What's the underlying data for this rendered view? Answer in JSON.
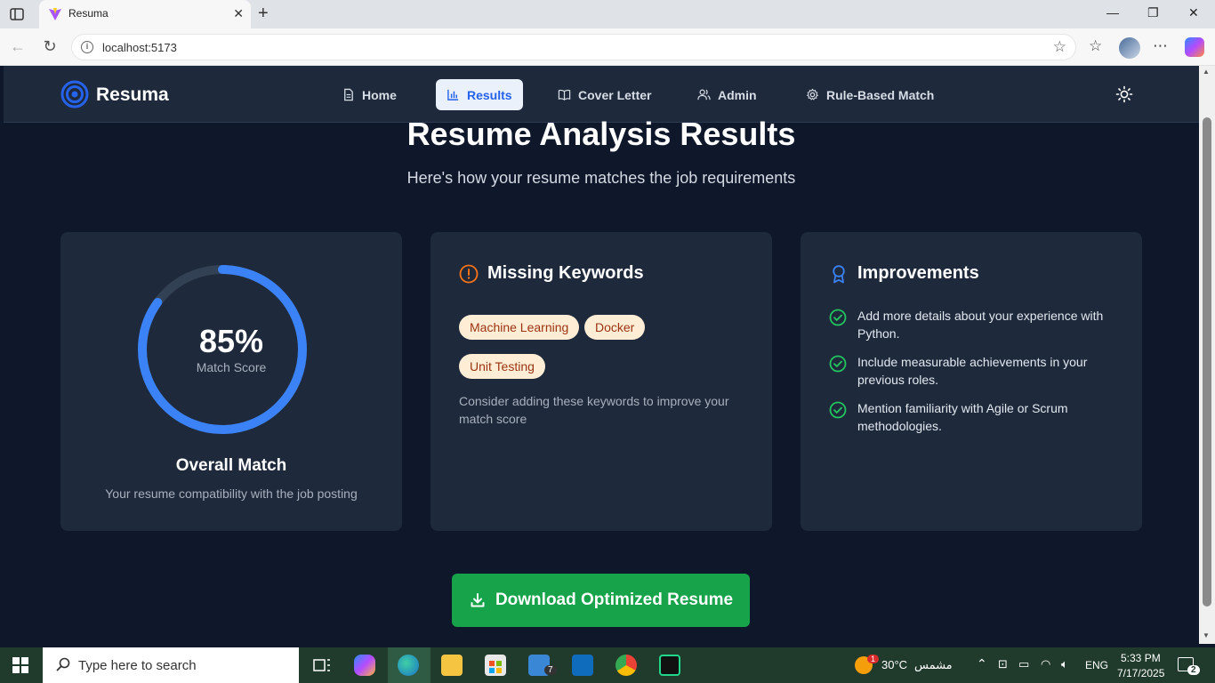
{
  "browser": {
    "tab_title": "Resuma",
    "url": "localhost:5173"
  },
  "app": {
    "brand": "Resuma",
    "nav": [
      {
        "label": "Home",
        "icon": "document-icon"
      },
      {
        "label": "Results",
        "icon": "bar-chart-icon",
        "active": true
      },
      {
        "label": "Cover Letter",
        "icon": "book-open-icon"
      },
      {
        "label": "Admin",
        "icon": "users-icon"
      },
      {
        "label": "Rule-Based Match",
        "icon": "gear-icon"
      }
    ],
    "theme_toggle_icon": "sun-icon"
  },
  "page": {
    "title": "Resume Analysis Results",
    "subtitle": "Here's how your resume matches the job requirements"
  },
  "match": {
    "score_text": "85%",
    "score_value": 85,
    "score_label": "Match Score",
    "title": "Overall Match",
    "description": "Your resume compatibility with the job posting"
  },
  "missing": {
    "title": "Missing Keywords",
    "keywords": [
      "Machine Learning",
      "Docker",
      "Unit Testing"
    ],
    "hint": "Consider adding these keywords to improve your match score"
  },
  "improvements": {
    "title": "Improvements",
    "items": [
      "Add more details about your experience with Python.",
      "Include measurable achievements in your previous roles.",
      "Mention familiarity with Agile or Scrum methodologies."
    ]
  },
  "download_label": "Download Optimized Resume",
  "colors": {
    "accent_blue": "#3b82f6",
    "success_green": "#16a34a",
    "warning_orange": "#f97316",
    "page_bg": "#0f172a",
    "card_bg": "#1e293b"
  },
  "taskbar": {
    "search_placeholder": "Type here to search",
    "weather_temp": "30°C",
    "weather_text": "مشمس",
    "weather_badge": "1",
    "language": "ENG",
    "time": "5:33 PM",
    "date": "7/17/2025",
    "notification_count": "2",
    "mail_badge": "7"
  }
}
